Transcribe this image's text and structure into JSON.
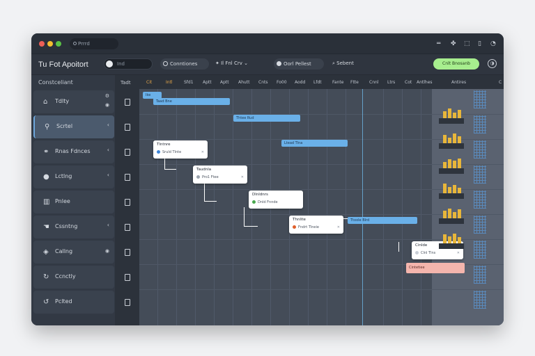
{
  "window": {
    "address_pill": "Prrrd",
    "title": "Tu Fot Apoitort"
  },
  "toolbar": {
    "search_value": "Ind",
    "btn_connections": "Conntiones",
    "plain_filter": "Il Fnl Crv",
    "btn_oper_pellest": "Oorl Pellest",
    "plain_sebent": "Sebent",
    "green_button": "Cnlt Bnosanb",
    "help_icon": "help-icon"
  },
  "sidebar": {
    "title": "Constceliant",
    "items": [
      {
        "label": "Tdlty",
        "icon": "building-icon"
      },
      {
        "label": "Scrtel",
        "icon": "search-icon"
      },
      {
        "label": "Rnas Fdnces",
        "icon": "nodes-icon"
      },
      {
        "label": "Lctlng",
        "icon": "user-icon"
      },
      {
        "label": "Pnlee",
        "icon": "chart-icon"
      },
      {
        "label": "Cssntng",
        "icon": "hand-icon"
      },
      {
        "label": "Callng",
        "icon": "pin-icon"
      },
      {
        "label": "Ccnctly",
        "icon": "refresh-icon"
      },
      {
        "label": "Pclted",
        "icon": "cycle-icon"
      }
    ]
  },
  "rowcol": {
    "header": "Tadt"
  },
  "timeline": {
    "headers": [
      "Cit",
      "Intl",
      "Sfd1",
      "Aptt",
      "Aptt",
      "Ahutt",
      "Cnts",
      "Fo00",
      "Aodd",
      "Lfdt",
      "Fante",
      "Ftte",
      "Cnnl",
      "Ltrs",
      "Cot",
      "Antlhes",
      "Antires",
      "C"
    ],
    "chips": [
      {
        "text": "Ike"
      },
      {
        "text": "Taad Bne"
      },
      {
        "text": "Thtee Rud"
      },
      {
        "text": "Ltead Tlna"
      },
      {
        "text": "Ttoole Blrd"
      },
      {
        "text": "Cintetiee"
      }
    ],
    "cards": [
      {
        "title": "Tlntnre",
        "sub": "Sruld Tlnte",
        "dot": "#3f86d8"
      },
      {
        "title": "Taudnla",
        "sub": "Pro1 Ftee",
        "dot": "#9aa3ad"
      },
      {
        "title": "Dlnldnrs",
        "sub": "Dnld Fnnde",
        "dot": "#4aa84f"
      },
      {
        "title": "Thnlite",
        "sub": "Fndrt Tlneie",
        "dot": "#e0602c"
      },
      {
        "title": "Cinlde",
        "sub": "Clnl Tlns",
        "dot": "#c9ced6"
      }
    ]
  }
}
